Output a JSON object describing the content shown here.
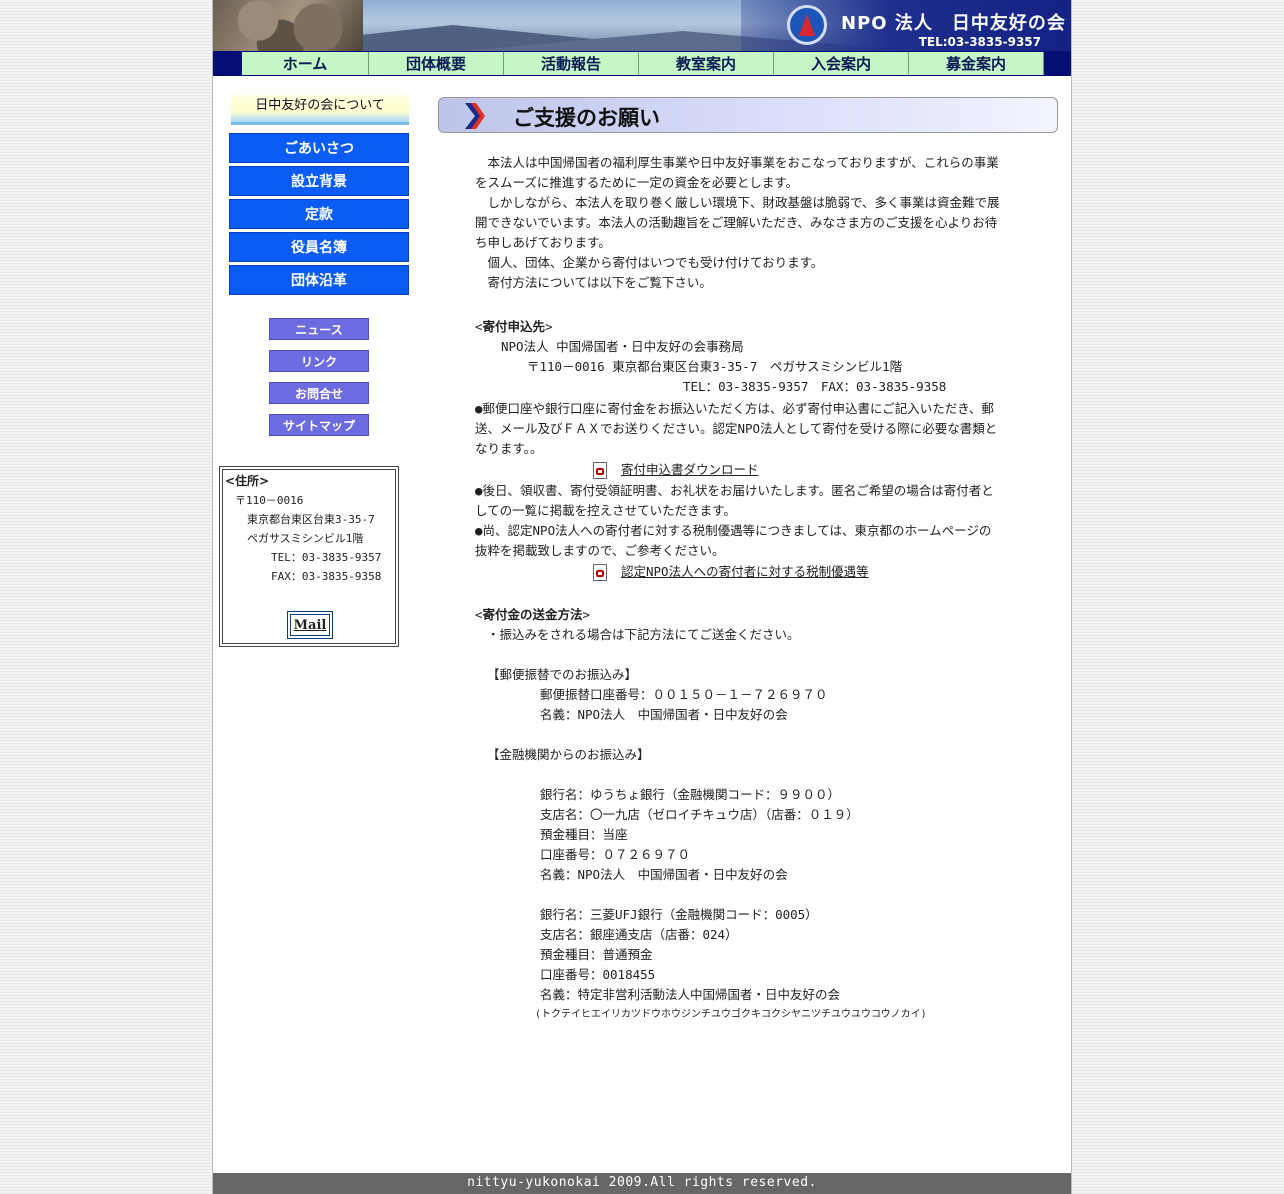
{
  "header": {
    "org_name": "NPO 法人　日中友好の会",
    "tel": "TEL:03-3835-9357"
  },
  "nav": [
    "ホーム",
    "団体概要",
    "活動報告",
    "教室案内",
    "入会案内",
    "募金案内"
  ],
  "sidebar": {
    "about_title": "日中友好の会について",
    "about_items": [
      "ごあいさつ",
      "設立背景",
      "定款",
      "役員名簿",
      "団体沿革"
    ],
    "small_items": [
      "ニュース",
      "リンク",
      "お問合せ",
      "サイトマップ"
    ],
    "address": {
      "title": "<住所>",
      "postal": "〒110－0016",
      "street": "東京都台東区台東3-35-7",
      "building": "ペガサスミシンビル1階",
      "tel": "TEL：03-3835-9357",
      "fax": "FAX：03-3835-9358",
      "mail_label": "Mail"
    }
  },
  "main": {
    "title": "ご支援のお願い",
    "intro": [
      "　本法人は中国帰国者の福利厚生事業や日中友好事業をおこなっておりますが、これらの事業",
      "をスムーズに推進するために一定の資金を必要とします。",
      "　しかしながら、本法人を取り巻く厳しい環境下、財政基盤は脆弱で、多く事業は資金難で展",
      "開できないでいます。本法人の活動趣旨をご理解いただき、みなさま方のご支援を心よりお待",
      "ち申しあげております。",
      "　個人、団体、企業から寄付はいつでも受け付けております。",
      "　寄付方法については以下をご覧下さい。"
    ],
    "apply": {
      "heading": "寄付申込先",
      "org": "NPO法人 中国帰国者・日中友好の会事務局",
      "address": "〒110－0016 東京都台東区台東3-35-7　ペガサスミシンビル1階",
      "telfax": "TEL：03-3835-9357　FAX：03-3835-9358",
      "note": [
        "●郵便口座や銀行口座に寄付金をお振込いただく方は、必ず寄付申込書にご記入いただき、郵",
        "送、メール及びＦＡＸでお送りください。認定NPO法人として寄付を受ける際に必要な書類と",
        "なります。。"
      ],
      "download_link": "寄付申込書ダウンロード",
      "note2": [
        "●後日、領収書、寄付受領証明書、お礼状をお届けいたします。匿名ご希望の場合は寄付者と",
        "しての一覧に掲載を控えさせていただきます。",
        "●尚、認定NPO法人への寄付者に対する税制優遇等につきましては、東京都のホームページの",
        "抜粋を掲載致しますので、ご参考ください。"
      ],
      "tax_link": "認定NPO法人への寄付者に対する税制優遇等"
    },
    "send": {
      "heading": "寄付金の送金方法",
      "intro": "・振込みをされる場合は下記方法にてご送金ください。",
      "postal_title": "【郵便振替でのお振込み】",
      "postal_lines": [
        "郵便振替口座番号：００１５０－１－７２６９７０",
        "名義：NPO法人　中国帰国者・日中友好の会"
      ],
      "bank_title": "【金融機関からのお振込み】",
      "bank1": [
        "銀行名：ゆうちょ銀行（金融機関コード：９９００）",
        "支店名：〇一九店（ゼロイチキュウ店）（店番：０１９）",
        "預金種目：当座",
        "口座番号：０７２６９７０",
        "名義：NPO法人　中国帰国者・日中友好の会"
      ],
      "bank2": [
        "銀行名：三菱UFJ銀行（金融機関コード：0005）",
        "支店名：銀座通支店（店番：024）",
        "預金種目：普通預金",
        "口座番号：0018455",
        "名義：特定非営利活動法人中国帰国者・日中友好の会"
      ],
      "kana": "(トクテイヒエイリカツドウホウジンチユウゴクキコクシヤニツチユウユウコウノカイ)"
    }
  },
  "footer": "nittyu-yukonokai 2009.All rights reserved."
}
